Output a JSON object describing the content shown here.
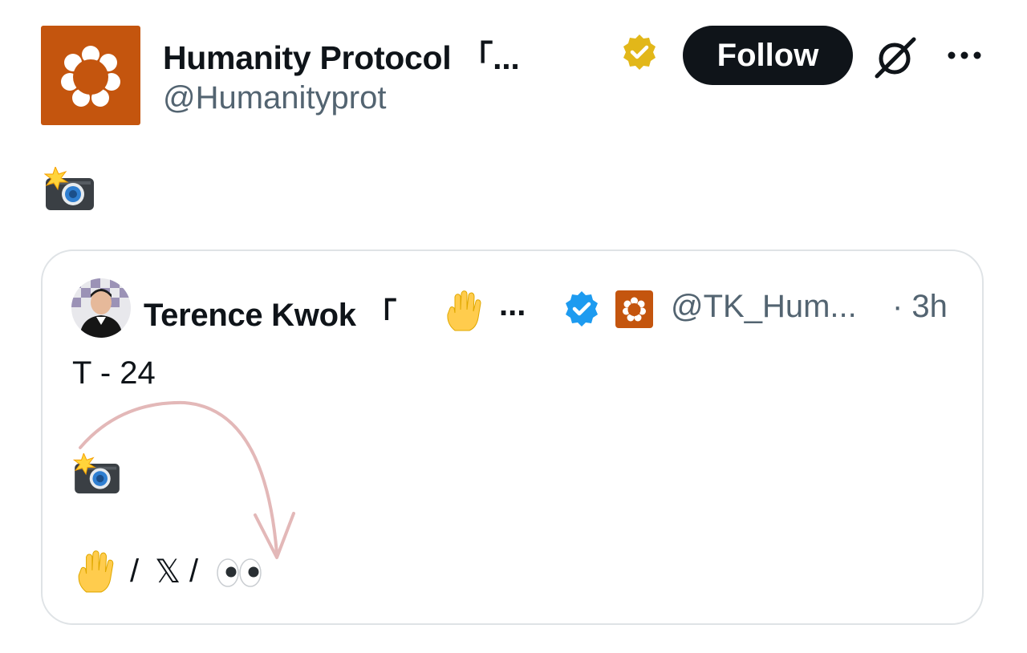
{
  "post": {
    "author": {
      "name": "Humanity Protocol 「...",
      "handle": "@Humanityprot",
      "avatar_icon": "humanity-protocol-logo",
      "avatar_color": "#c4550e",
      "badge": "gold-verified-badge"
    },
    "follow_label": "Follow",
    "grok_icon": "grok-icon",
    "more_icon": "more-icon",
    "body_icon": "camera-flash-emoji"
  },
  "quote": {
    "author_name": "Terence Kwok 「",
    "name_emoji": "raised-hand-emoji",
    "name_ellipsis": "...",
    "badge": "blue-verified-badge",
    "org_icon": "humanity-protocol-logo",
    "handle": "@TK_Hum...",
    "time": "· 3h",
    "text": "T - 24",
    "lines": {
      "icon_camera": "camera-flash-emoji",
      "slash1": "/",
      "x_symbol": "𝕏",
      "slash2": "/",
      "hand_icon": "raised-hand-emoji",
      "eyes_icon": "eyes-emoji"
    },
    "annotation": "curved-arrow"
  },
  "colors": {
    "brand_orange": "#c4550e",
    "verified_blue": "#1d9bf0",
    "gold": "#e2b719",
    "muted_text": "#536471",
    "arrow": "#e3b8b8"
  }
}
